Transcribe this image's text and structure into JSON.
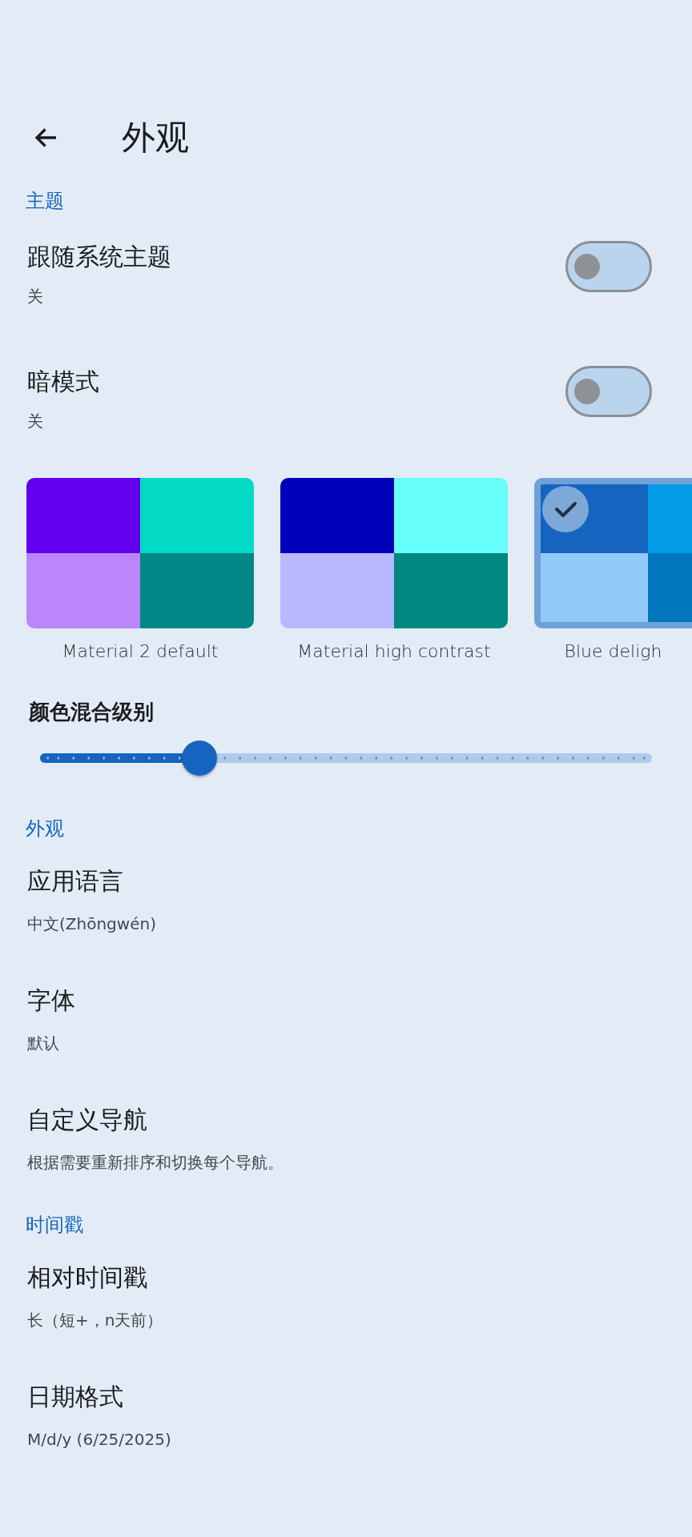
{
  "header": {
    "title": "外观"
  },
  "sections": [
    {
      "title": "主题",
      "items": [
        {
          "kind": "switch",
          "title": "跟随系统主题",
          "subtitle": "关",
          "on": false
        },
        {
          "kind": "switch",
          "title": "暗模式",
          "subtitle": "关",
          "on": false
        },
        {
          "kind": "themes",
          "themes": [
            {
              "name": "Material 2 default",
              "selected": false,
              "swatches": [
                {
                  "color": "#6200ee"
                },
                {
                  "color": "#03dac6"
                },
                {
                  "color": "#bb86fc"
                },
                {
                  "color": "#018786"
                }
              ]
            },
            {
              "name": "Material high contrast",
              "selected": false,
              "swatches": [
                {
                  "color": "#0000ba"
                },
                {
                  "color": "#66fff9"
                },
                {
                  "color": "#b8b8ff"
                },
                {
                  "color": "#008780"
                }
              ]
            },
            {
              "name": "Blue deligh",
              "selected": true,
              "swatches": [
                {
                  "color": "#1565c0"
                },
                {
                  "color": "#039be5"
                },
                {
                  "color": "#90caf9"
                },
                {
                  "color": "#0277bd"
                }
              ]
            }
          ]
        },
        {
          "kind": "slider",
          "title": "颜色混合级别",
          "level": 0.26
        }
      ]
    },
    {
      "title": "外观",
      "items": [
        {
          "kind": "setting",
          "title": "应用语言",
          "subtitle": "中文(Zhōngwén)"
        },
        {
          "kind": "setting",
          "title": "字体",
          "subtitle": "默认"
        },
        {
          "kind": "setting",
          "title": "自定义导航",
          "subtitle": "根据需要重新排序和切换每个导航。"
        }
      ]
    },
    {
      "title": "时间戳",
      "items": [
        {
          "kind": "setting",
          "title": "相对时间戳",
          "subtitle": "长（短+，n天前）"
        },
        {
          "kind": "setting",
          "title": "日期格式",
          "subtitle": "M/d/y (6/25/2025)"
        }
      ]
    }
  ]
}
